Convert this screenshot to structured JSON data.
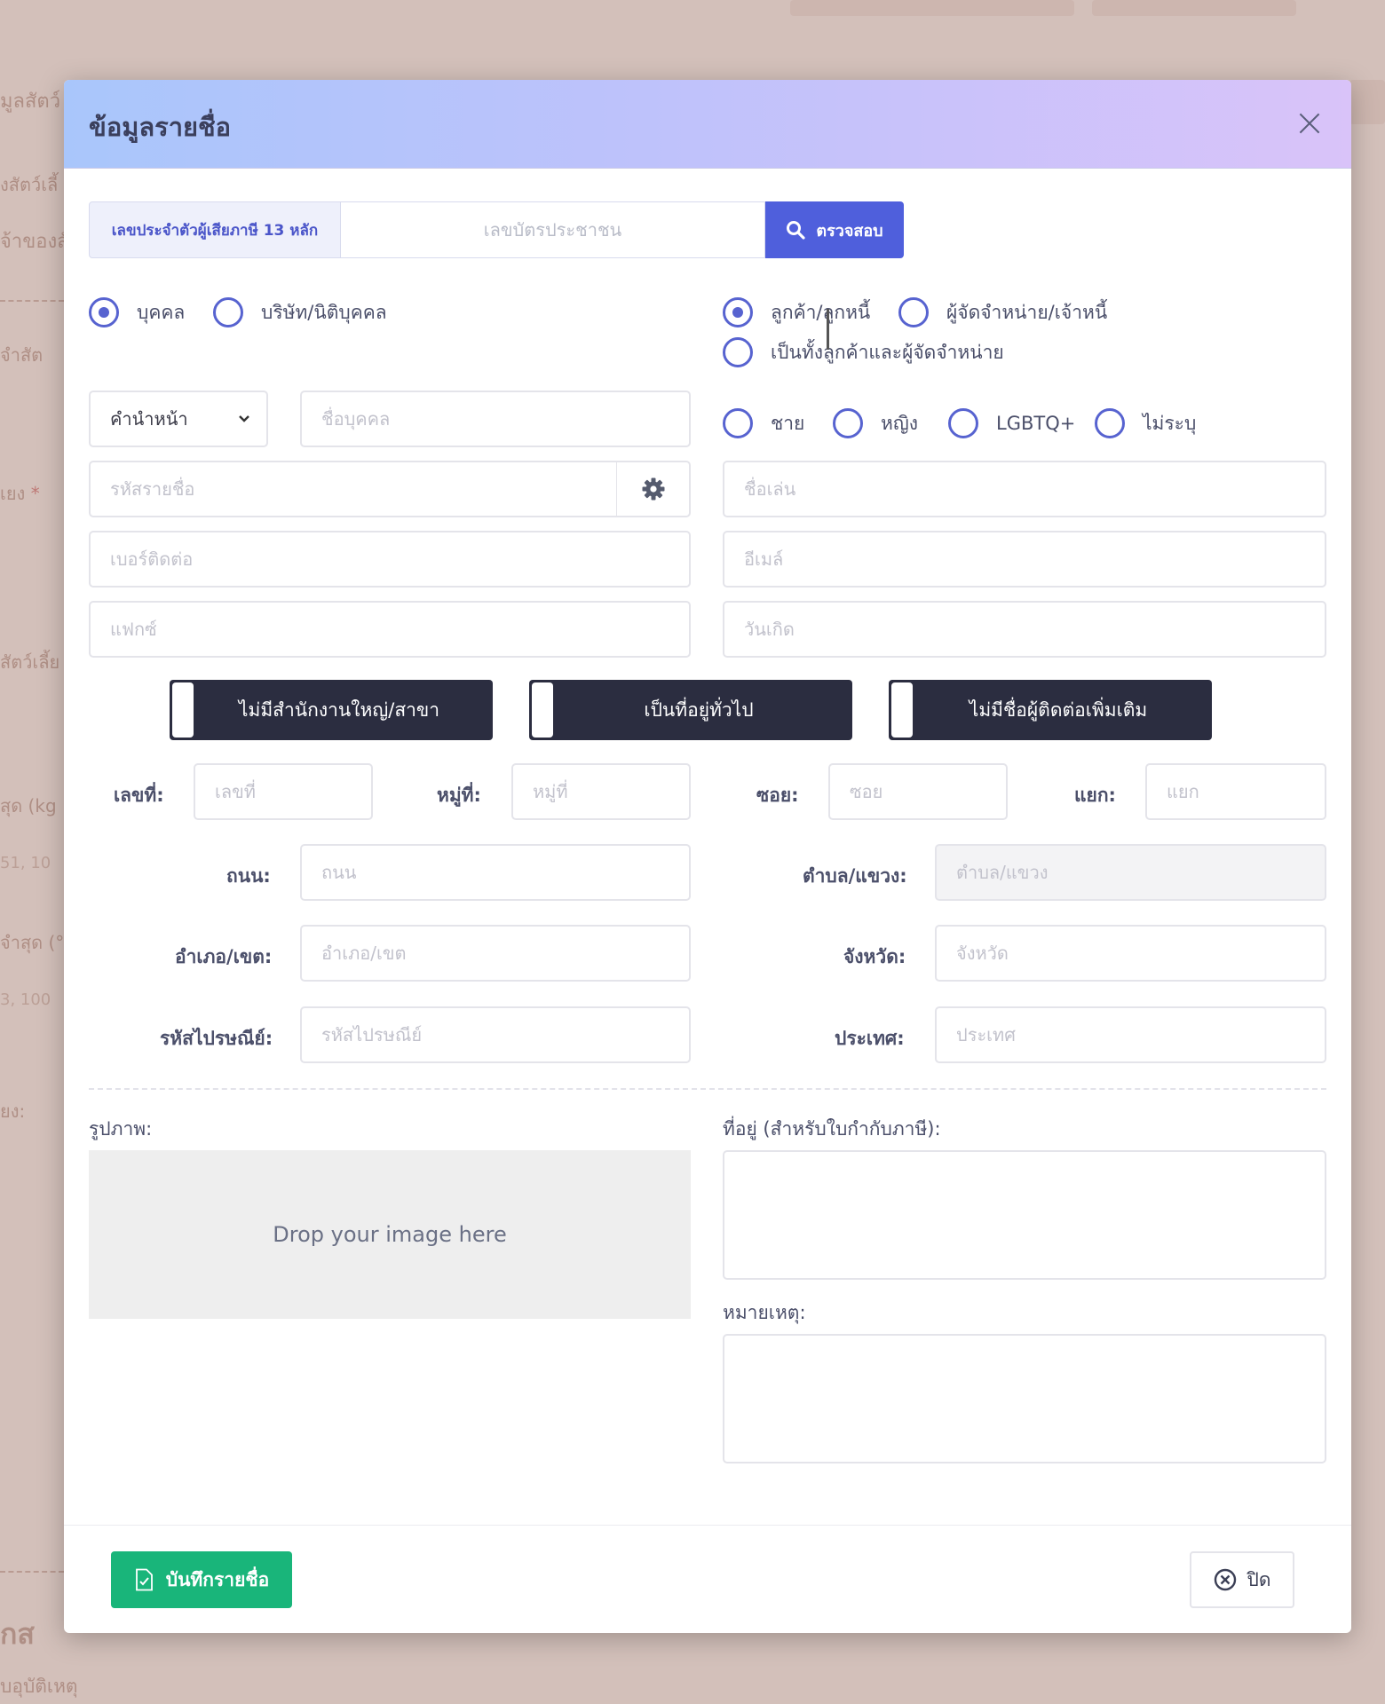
{
  "background": {
    "lines": [
      "มูลสัตว์",
      "งสัตว์เลี้",
      "จ้าของสั",
      "จำสัต",
      "เยง",
      "สัตว์เลี้ย",
      "สุด (kg",
      "51, 10",
      "จำสุด (°F",
      "3, 100",
      "ยง:",
      "กส",
      "บอุบัติเหตุ"
    ],
    "asterisk": "*"
  },
  "modal": {
    "title": "ข้อมูลรายชื่อ",
    "tax": {
      "label": "เลขประจำตัวผู้เสียภาษี 13 หลัก",
      "placeholder": "เลขบัตรประชาชน",
      "check_label": "ตรวจสอบ"
    },
    "entity_type": {
      "person": "บุคคล",
      "company": "บริษัท/นิติบุคคล"
    },
    "contact_type": {
      "customer": "ลูกค้า/ลูกหนี้",
      "supplier": "ผู้จัดจำหน่าย/เจ้าหนี้",
      "both": "เป็นทั้งลูกค้าและผู้จัดจำหน่าย"
    },
    "prefix_select": "คำนำหน้า",
    "placeholders": {
      "person_name": "ชื่อบุคคล",
      "code": "รหัสรายชื่อ",
      "phone": "เบอร์ติดต่อ",
      "fax": "แฟกซ์",
      "nickname": "ชื่อเล่น",
      "email": "อีเมล์",
      "birthday": "วันเกิด"
    },
    "gender": {
      "male": "ชาย",
      "female": "หญิง",
      "lgbtq": "LGBTQ+",
      "unspecified": "ไม่ระบุ"
    },
    "toggles": {
      "branch": "ไม่มีสำนักงานใหญ่/สาขา",
      "address_type": "เป็นที่อยู่ทั่วไป",
      "extra_contact": "ไม่มีชื่อผู้ติดต่อเพิ่มเติม"
    },
    "address": {
      "house_no_label": "เลขที่:",
      "house_no_ph": "เลขที่",
      "moo_label": "หมู่ที่:",
      "moo_ph": "หมู่ที่",
      "soi_label": "ซอย:",
      "soi_ph": "ซอย",
      "yaek_label": "แยก:",
      "yaek_ph": "แยก",
      "road_label": "ถนน:",
      "road_ph": "ถนน",
      "subdistrict_label": "ตำบล/แขวง:",
      "subdistrict_ph": "ตำบล/แขวง",
      "district_label": "อำเภอ/เขต:",
      "district_ph": "อำเภอ/เขต",
      "province_label": "จังหวัด:",
      "province_ph": "จังหวัด",
      "postcode_label": "รหัสไปรษณีย์:",
      "postcode_ph": "รหัสไปรษณีย์",
      "country_label": "ประเทศ:",
      "country_ph": "ประเทศ"
    },
    "image_label": "รูปภาพ:",
    "dropzone": "Drop your image here",
    "tax_address_label": "ที่อยู่ (สำหรับใบกำกับภาษี):",
    "note_label": "หมายเหตุ:",
    "save_label": "บันทึกรายชื่อ",
    "close_label": "ปิด"
  },
  "colors": {
    "primary": "#4f5fdc",
    "radio": "#5763d0",
    "toggle": "#2b2d40",
    "save": "#19b57a"
  }
}
